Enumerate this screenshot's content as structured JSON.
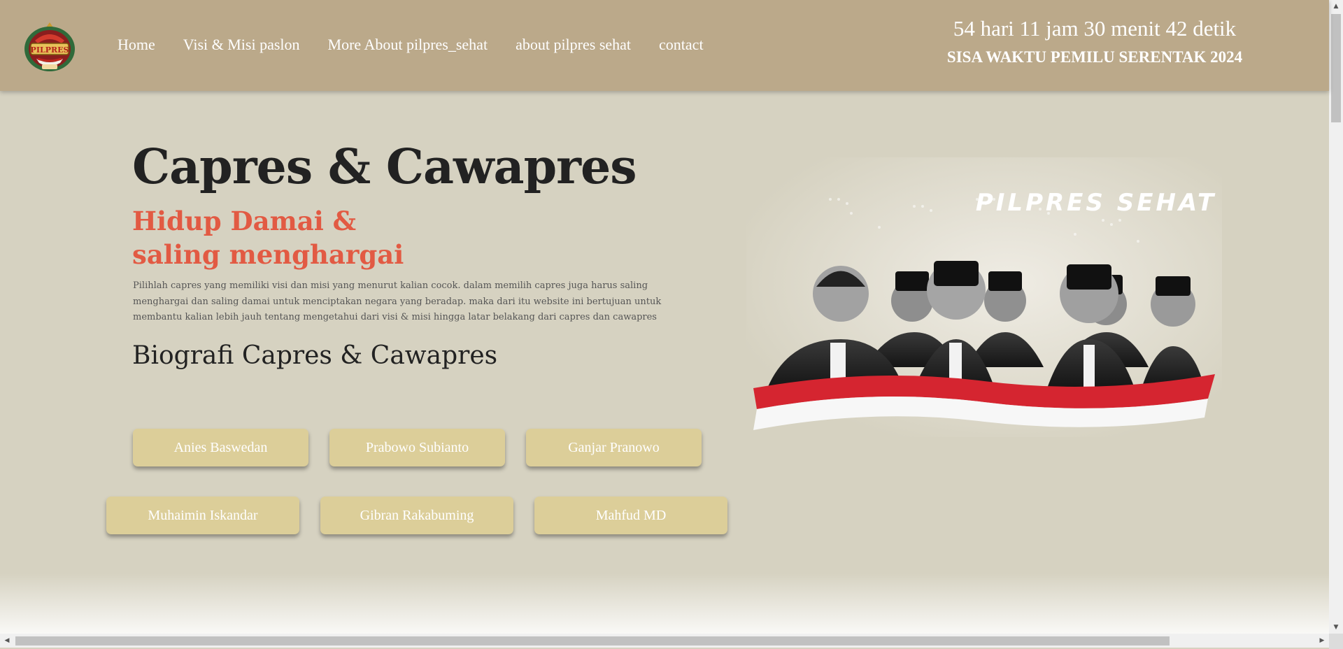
{
  "nav": {
    "logo_text": "PILPRES",
    "items": [
      {
        "label": "Home"
      },
      {
        "label": "Visi & Misi paslon"
      },
      {
        "label": "More About pilpres_sehat"
      },
      {
        "label": "about pilpres sehat"
      },
      {
        "label": "contact"
      }
    ]
  },
  "countdown": {
    "time": "54 hari 11 jam 30 menit 42 detik",
    "label": "SISA WAKTU PEMILU SERENTAK 2024"
  },
  "hero": {
    "title": "Capres & Cawapres",
    "subtitle_line1": "Hidup Damai &",
    "subtitle_line2": "saling menghargai",
    "description": "Pilihlah capres yang memiliki visi dan misi yang menurut kalian cocok. dalam memilih capres juga harus saling menghargai dan saling damai untuk menciptakan negara yang beradap. maka dari itu website ini bertujuan untuk membantu kalian lebih jauh tentang mengetahui dari visi & misi hingga latar belakang dari capres dan cawapres",
    "bio_title": "Biografi Capres & Cawapres"
  },
  "candidates": {
    "row1": [
      "Anies Baswedan",
      "Prabowo Subianto",
      "Ganjar Pranowo"
    ],
    "row2": [
      "Muhaimin Iskandar",
      "Gibran Rakabuming",
      "Mahfud MD"
    ]
  },
  "poster": {
    "title": "PILPRES SEHAT"
  },
  "colors": {
    "header_bg": "#bba98a",
    "page_bg": "#d6d2c1",
    "accent_red": "#e25a43",
    "button_bg": "#dcce99"
  }
}
